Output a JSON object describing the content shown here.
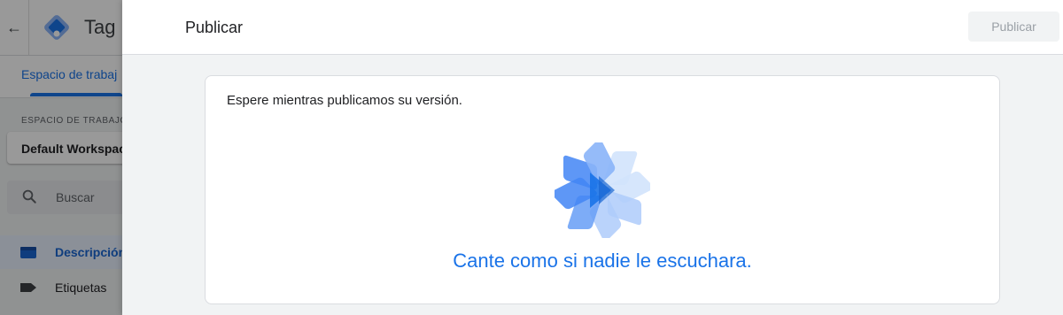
{
  "app": {
    "back_icon": "arrow-back-icon",
    "logo_icon": "tag-manager-logo",
    "title": "Tag M"
  },
  "tabs": {
    "active_label": "Espacio de trabaj"
  },
  "sidebar": {
    "workspace_label": "ESPACIO DE TRABAJO",
    "workspace_value": "Default Workspace",
    "search_placeholder": "Buscar",
    "items": [
      {
        "label": "Descripción",
        "icon": "overview-icon",
        "active": true
      },
      {
        "label": "Etiquetas",
        "icon": "tag-icon",
        "active": false
      }
    ]
  },
  "panel": {
    "title": "Publicar",
    "publish_button": "Publicar",
    "message": "Espere mientras publicamos su versión.",
    "quote": "Cante como si nadie le escuchara.",
    "spinner_icon": "loading-pinwheel-icon"
  },
  "colors": {
    "accent": "#1a73e8",
    "panel_bg": "#f1f3f4",
    "scrim": "rgba(0,0,0,0.40)"
  }
}
